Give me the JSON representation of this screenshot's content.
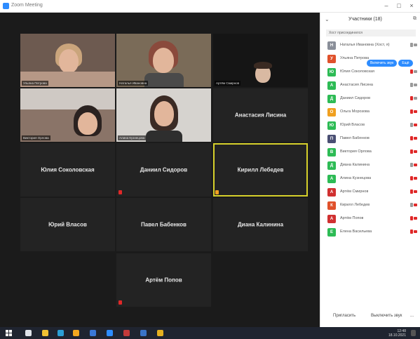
{
  "window": {
    "title": "Zoom Meeting"
  },
  "gallery": {
    "video_tiles": [
      {
        "label": "Ульяна Петрова"
      },
      {
        "label": "Наталья Ивановна"
      },
      {
        "label": "Артём Смирнов"
      },
      {
        "label": "Виктория Орлова"
      },
      {
        "label": "Алина Кузнецова"
      }
    ],
    "name_tiles": [
      {
        "name": "Анастасия Лисина"
      },
      {
        "name": "Юлия Соколовская"
      },
      {
        "name": "Даниил Сидоров"
      },
      {
        "name": "Кирилл Лебедев"
      },
      {
        "name": "Юрий Власов"
      },
      {
        "name": "Павел Бабенков"
      },
      {
        "name": "Диана Калинина"
      },
      {
        "name": "Артём Попов"
      }
    ]
  },
  "participants_panel": {
    "title": "Участники (18)",
    "collapse_icon": "chevron-down-icon",
    "popout_icon": "popout-icon",
    "host_bar": "Хост присоединился",
    "unmute_label": "Включить звук",
    "more_label": "Ещё",
    "items": [
      {
        "initial": "Н",
        "name": "Наталья Ивановна (Хост, я)",
        "color": "#8a8f99"
      },
      {
        "initial": "У",
        "name": "Ульяна Петрова",
        "color": "#e0512b"
      },
      {
        "initial": "Ю",
        "name": "Юлия Соколовская",
        "color": "#2dbb55"
      },
      {
        "initial": "А",
        "name": "Анастасия Лисина",
        "color": "#2dbb55"
      },
      {
        "initial": "Д",
        "name": "Даниил Сидоров",
        "color": "#2dbb55"
      },
      {
        "initial": "О",
        "name": "Ольга Морозова",
        "color": "#f0a020"
      },
      {
        "initial": "Ю",
        "name": "Юрий Власов",
        "color": "#2dbb55"
      },
      {
        "initial": "П",
        "name": "Павел Бабенков",
        "color": "#4a4f73"
      },
      {
        "initial": "В",
        "name": "Виктория Орлова",
        "color": "#2dbb55"
      },
      {
        "initial": "Д",
        "name": "Диана Калинина",
        "color": "#2dbb55"
      },
      {
        "initial": "А",
        "name": "Алина Кузнецова",
        "color": "#2dbb55"
      },
      {
        "initial": "А",
        "name": "Артём Смирнов",
        "color": "#d03030"
      },
      {
        "initial": "К",
        "name": "Кирилл Лебедев",
        "color": "#e0512b"
      },
      {
        "initial": "А",
        "name": "Артём Попов",
        "color": "#d03030"
      },
      {
        "initial": "Е",
        "name": "Елена Васильева",
        "color": "#2dbb55"
      }
    ],
    "footer": {
      "invite": "Пригласить",
      "mute_all": "Выключить звук",
      "more": "..."
    }
  },
  "taskbar": {
    "time": "12:48",
    "date": "18.10.2021"
  },
  "colors": {
    "active_speaker": "#d6d02b",
    "accent": "#2d8cff",
    "muted": "#e02828"
  }
}
